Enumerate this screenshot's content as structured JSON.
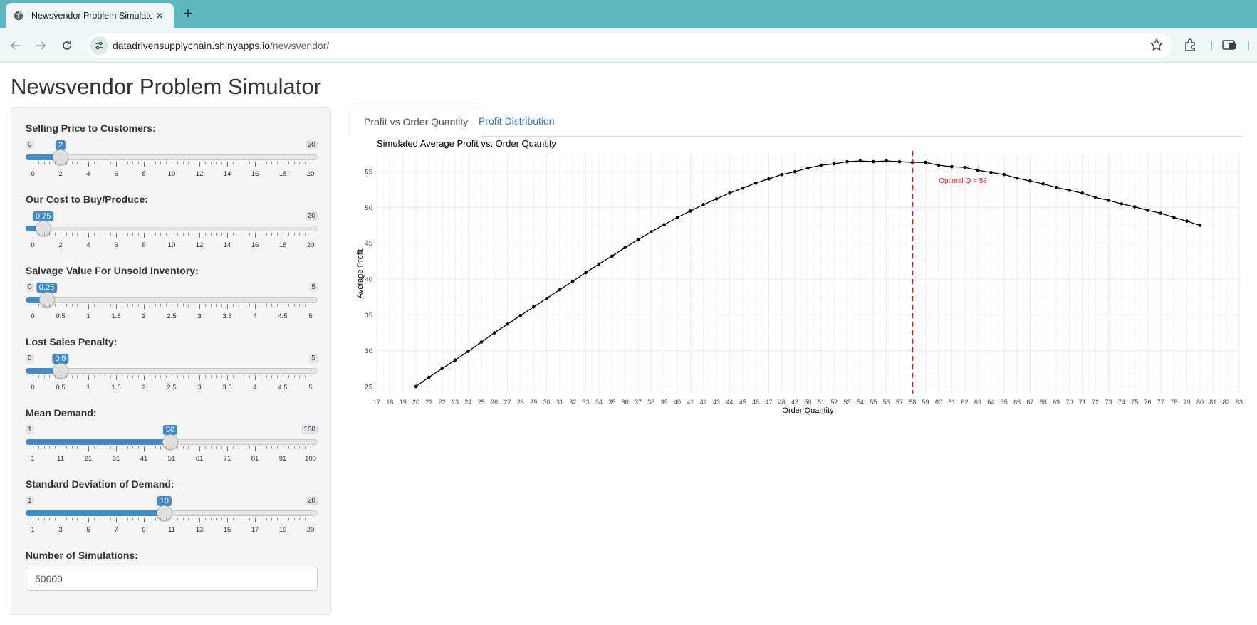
{
  "browser": {
    "tab_title": "Newsvendor Problem Simulator",
    "new_tab": "+",
    "url_host": "datadrivensupplychain.shinyapps.io",
    "url_path": "/newsvendor/"
  },
  "page": {
    "title": "Newsvendor Problem Simulator"
  },
  "sliders": [
    {
      "label": "Selling Price to Customers:",
      "min": 0,
      "max": 20,
      "value": 2,
      "value_label": "2",
      "min_label": "0",
      "max_label": "20",
      "show_min": true,
      "ticks": [
        "0",
        "2",
        "4",
        "6",
        "8",
        "10",
        "12",
        "14",
        "16",
        "18",
        "20"
      ]
    },
    {
      "label": "Our Cost to Buy/Produce:",
      "min": 0,
      "max": 20,
      "value": 0.75,
      "value_label": "0.75",
      "min_label": "0",
      "max_label": "20",
      "show_min": false,
      "ticks": [
        "0",
        "2",
        "4",
        "6",
        "8",
        "10",
        "12",
        "14",
        "16",
        "18",
        "20"
      ]
    },
    {
      "label": "Salvage Value For Unsold Inventory:",
      "min": 0,
      "max": 5,
      "value": 0.25,
      "value_label": "0.25",
      "min_label": "0",
      "max_label": "5",
      "show_min": true,
      "ticks": [
        "0",
        "0.5",
        "1",
        "1.5",
        "2",
        "2.5",
        "3",
        "3.5",
        "4",
        "4.5",
        "5"
      ]
    },
    {
      "label": "Lost Sales Penalty:",
      "min": 0,
      "max": 5,
      "value": 0.5,
      "value_label": "0.5",
      "min_label": "0",
      "max_label": "5",
      "show_min": true,
      "ticks": [
        "0",
        "0.5",
        "1",
        "1.5",
        "2",
        "2.5",
        "3",
        "3.5",
        "4",
        "4.5",
        "5"
      ]
    },
    {
      "label": "Mean Demand:",
      "min": 1,
      "max": 100,
      "value": 50,
      "value_label": "50",
      "min_label": "1",
      "max_label": "100",
      "show_min": true,
      "ticks": [
        "1",
        "11",
        "21",
        "31",
        "41",
        "51",
        "61",
        "71",
        "81",
        "91",
        "100"
      ]
    },
    {
      "label": "Standard Deviation of Demand:",
      "min": 1,
      "max": 20,
      "value": 10,
      "value_label": "10",
      "min_label": "1",
      "max_label": "20",
      "show_min": true,
      "ticks": [
        "1",
        "3",
        "5",
        "7",
        "9",
        "11",
        "13",
        "15",
        "17",
        "19",
        "20"
      ]
    }
  ],
  "simulations": {
    "label": "Number of Simulations:",
    "value": "50000"
  },
  "tabs": {
    "active": "Profit vs Order Quantity",
    "inactive": "Profit Distribution"
  },
  "chart_data": {
    "type": "line",
    "title": "Simulated Average Profit vs. Order Quantity",
    "xlabel": "Order Quantity",
    "ylabel": "Average Profit",
    "xlim": [
      17,
      83
    ],
    "ylim": [
      24,
      57.5
    ],
    "x_ticks": [
      17,
      18,
      19,
      20,
      21,
      22,
      23,
      24,
      25,
      26,
      27,
      28,
      29,
      30,
      31,
      32,
      33,
      34,
      35,
      36,
      37,
      38,
      39,
      40,
      41,
      42,
      43,
      44,
      45,
      46,
      47,
      48,
      49,
      50,
      51,
      52,
      53,
      54,
      55,
      56,
      57,
      58,
      59,
      60,
      61,
      62,
      63,
      64,
      65,
      66,
      67,
      68,
      69,
      70,
      71,
      72,
      73,
      74,
      75,
      76,
      77,
      78,
      79,
      80,
      81,
      82,
      83
    ],
    "y_ticks": [
      25,
      30,
      35,
      40,
      45,
      50,
      55
    ],
    "grid": true,
    "x": [
      20,
      21,
      22,
      23,
      24,
      25,
      26,
      27,
      28,
      29,
      30,
      31,
      32,
      33,
      34,
      35,
      36,
      37,
      38,
      39,
      40,
      41,
      42,
      43,
      44,
      45,
      46,
      47,
      48,
      49,
      50,
      51,
      52,
      53,
      54,
      55,
      56,
      57,
      58,
      59,
      60,
      61,
      62,
      63,
      64,
      65,
      66,
      67,
      68,
      69,
      70,
      71,
      72,
      73,
      74,
      75,
      76,
      77,
      78,
      79,
      80
    ],
    "y": [
      25.0,
      26.3,
      27.5,
      28.7,
      29.9,
      31.2,
      32.5,
      33.7,
      34.9,
      36.1,
      37.3,
      38.5,
      39.7,
      40.9,
      42.1,
      43.2,
      44.4,
      45.5,
      46.6,
      47.6,
      48.6,
      49.5,
      50.4,
      51.2,
      52.0,
      52.7,
      53.4,
      54.0,
      54.6,
      55.0,
      55.5,
      55.9,
      56.1,
      56.4,
      56.5,
      56.4,
      56.5,
      56.4,
      56.3,
      56.3,
      55.9,
      55.7,
      55.6,
      55.2,
      54.9,
      54.6,
      54.1,
      53.7,
      53.3,
      52.8,
      52.4,
      52.0,
      51.4,
      51.0,
      50.5,
      50.1,
      49.6,
      49.2,
      48.6,
      48.1,
      47.5
    ],
    "optimal_q": 58,
    "optimal_label": "Optimal Q = 58",
    "colors": {
      "line": "#000000",
      "optimal": "#e31a1c",
      "grid": "#ebebeb"
    }
  }
}
